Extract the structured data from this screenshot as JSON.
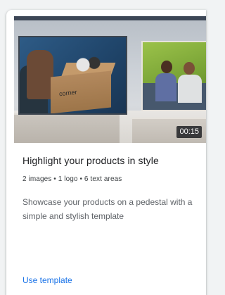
{
  "card": {
    "duration": "00:15",
    "title": "Highlight your products in style",
    "meta": "2 images • 1 logo • 6 text areas",
    "description": "Showcase your products on a pedestal with a simple and stylish template",
    "action_label": "Use template",
    "box_brand": "corner"
  },
  "colors": {
    "accent": "#1a73e8",
    "title": "#202124",
    "secondary": "#5f6368"
  }
}
